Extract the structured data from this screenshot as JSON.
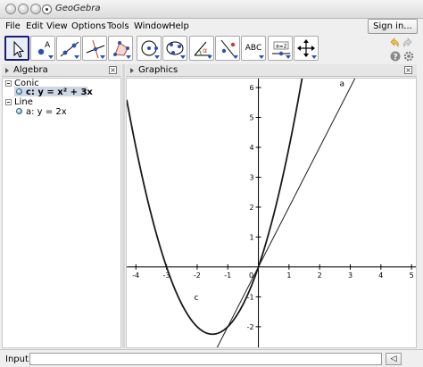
{
  "window": {
    "title": "GeoGebra"
  },
  "menu": {
    "items": [
      "File",
      "Edit",
      "View",
      "Options",
      "Tools",
      "Window",
      "Help"
    ],
    "sign_in": "Sign in..."
  },
  "toolbar": {
    "tools": [
      {
        "name": "move-tool-icon",
        "selected": true
      },
      {
        "name": "new-point-tool-icon",
        "label": "A"
      },
      {
        "name": "line-through-two-points-tool-icon"
      },
      {
        "name": "perpendicular-line-tool-icon"
      },
      {
        "name": "polygon-tool-icon"
      },
      {
        "name": "circle-center-point-tool-icon"
      },
      {
        "name": "ellipse-tool-icon"
      },
      {
        "name": "angle-tool-icon",
        "label": "α"
      },
      {
        "name": "reflect-about-line-tool-icon"
      },
      {
        "name": "insert-text-tool-icon",
        "label": "ABC"
      },
      {
        "name": "slider-tool-icon",
        "label": "a=2"
      },
      {
        "name": "move-graphics-view-tool-icon"
      }
    ],
    "utilities": [
      "undo-icon",
      "help-icon",
      "settings-icon"
    ]
  },
  "algebra": {
    "title": "Algebra",
    "groups": [
      {
        "label": "Conic",
        "items": [
          {
            "text": "c: y = x² + 3x",
            "selected": true
          }
        ]
      },
      {
        "label": "Line",
        "items": [
          {
            "text": "a: y = 2x",
            "selected": false
          }
        ]
      }
    ]
  },
  "graphics": {
    "title": "Graphics",
    "x_ticks": [
      "-4",
      "-3",
      "-2",
      "-1",
      "0",
      "1",
      "2",
      "3",
      "4",
      "5"
    ],
    "y_ticks": [
      "6",
      "5",
      "4",
      "3",
      "2",
      "1",
      "-1",
      "-2"
    ],
    "x_range": [
      -4.3,
      5.2
    ],
    "y_range": [
      -2.75,
      6.3
    ],
    "objects": [
      {
        "label": "c",
        "kind": "parabola",
        "equation": "y = x² + 3x"
      },
      {
        "label": "a",
        "kind": "line",
        "equation": "y = 2x"
      }
    ]
  },
  "input": {
    "label": "Input:",
    "value": "",
    "button_glyph": "◁"
  },
  "colors": {
    "curve": "#1a1a1a",
    "selection": "#cfd6e6",
    "accent": "#1b1b7a"
  }
}
